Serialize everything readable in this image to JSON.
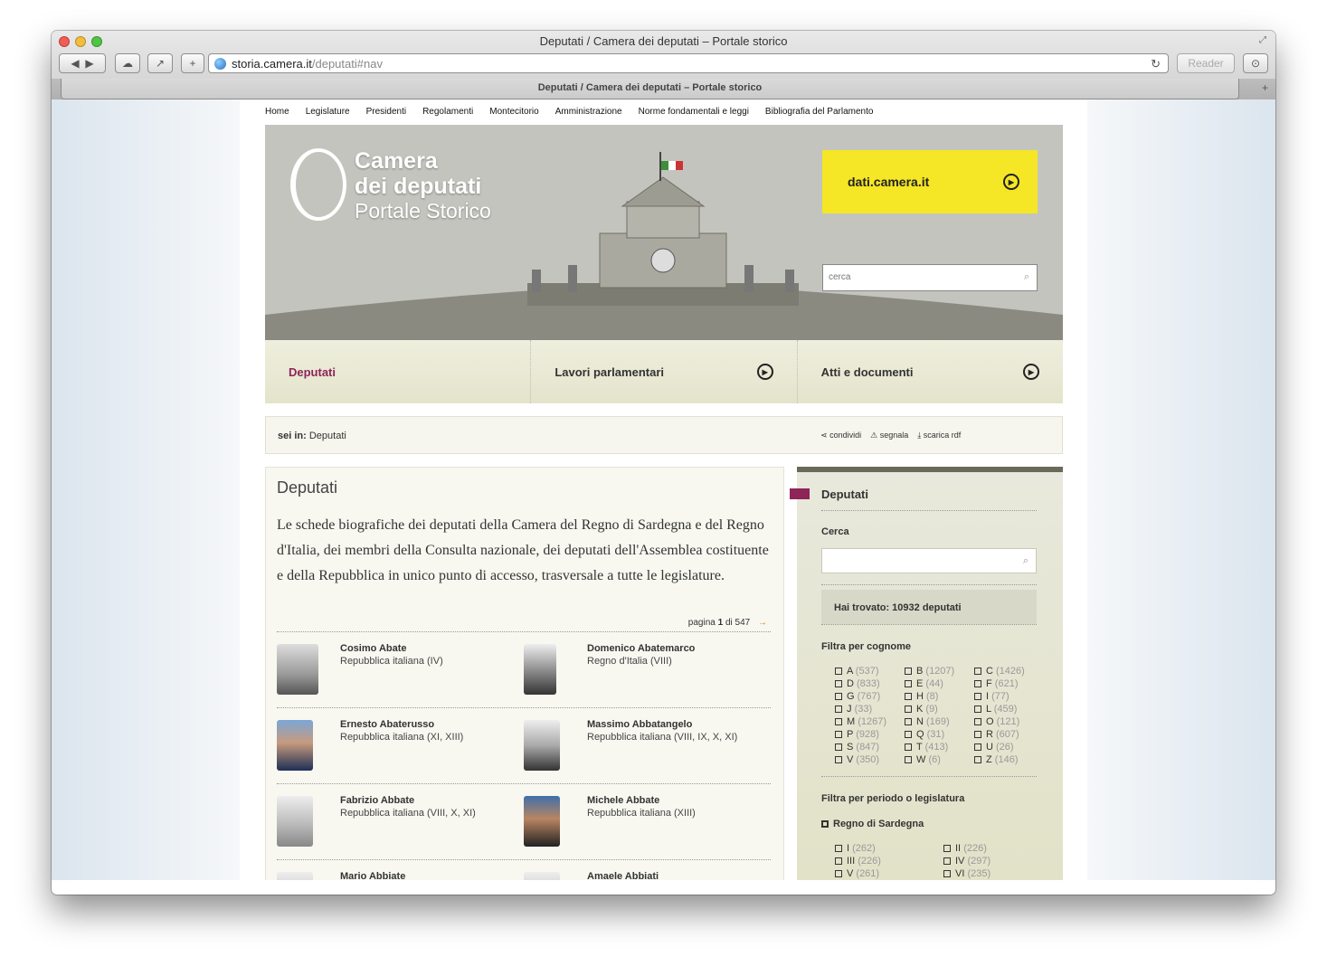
{
  "window": {
    "title": "Deputati / Camera dei deputati – Portale storico",
    "tab_title": "Deputati / Camera dei deputati – Portale storico"
  },
  "toolbar": {
    "back": "◀",
    "forward": "▶",
    "add": "+",
    "reader": "Reader"
  },
  "url": {
    "host": "storia.camera.it",
    "path": "/deputati#nav"
  },
  "topnav": [
    "Home",
    "Legislature",
    "Presidenti",
    "Regolamenti",
    "Montecitorio",
    "Amministrazione",
    "Norme fondamentali e leggi",
    "Bibliografia del Parlamento"
  ],
  "hero": {
    "logo_line1": "Camera",
    "logo_line2": "dei deputati",
    "logo_line3": "Portale Storico",
    "dati_label": "dati.camera.it",
    "search_placeholder": "cerca"
  },
  "sections": [
    {
      "label": "Deputati"
    },
    {
      "label": "Lavori parlamentari"
    },
    {
      "label": "Atti e documenti"
    }
  ],
  "breadcrumb": {
    "prefix": "sei in:",
    "current": "Deputati",
    "share": "condividi",
    "report": "segnala",
    "download": "scarica rdf"
  },
  "main": {
    "title": "Deputati",
    "intro": "Le schede biografiche dei deputati della Camera del Regno di Sardegna e del Regno d'Italia, dei membri della Consulta nazionale, dei deputati dell'Assemblea costituente e della Repubblica in unico punto di accesso, trasversale a tutte le legislature.",
    "pager_word": "pagina",
    "page_current": "1",
    "pager_of": "di",
    "page_total": "547",
    "deputies": [
      {
        "name": "Cosimo Abate",
        "leg": "Repubblica italiana (IV)"
      },
      {
        "name": "Domenico Abatemarco",
        "leg": "Regno d'Italia (VIII)"
      },
      {
        "name": "Ernesto Abaterusso",
        "leg": "Repubblica italiana (XI, XIII)"
      },
      {
        "name": "Massimo Abbatangelo",
        "leg": "Repubblica italiana (VIII, IX, X, XI)"
      },
      {
        "name": "Fabrizio Abbate",
        "leg": "Repubblica italiana (VIII, X, XI)"
      },
      {
        "name": "Michele Abbate",
        "leg": "Repubblica italiana (XIII)"
      },
      {
        "name": "Mario Abbiate",
        "leg": ""
      },
      {
        "name": "Amaele Abbiati",
        "leg": ""
      }
    ]
  },
  "sidebar": {
    "title": "Deputati",
    "search_label": "Cerca",
    "found": "Hai trovato: 10932 deputati",
    "filter_surname": "Filtra per cognome",
    "letters": [
      {
        "l": "A",
        "c": "(537)"
      },
      {
        "l": "B",
        "c": "(1207)"
      },
      {
        "l": "C",
        "c": "(1426)"
      },
      {
        "l": "D",
        "c": "(833)"
      },
      {
        "l": "E",
        "c": "(44)"
      },
      {
        "l": "F",
        "c": "(621)"
      },
      {
        "l": "G",
        "c": "(767)"
      },
      {
        "l": "H",
        "c": "(8)"
      },
      {
        "l": "I",
        "c": "(77)"
      },
      {
        "l": "J",
        "c": "(33)"
      },
      {
        "l": "K",
        "c": "(9)"
      },
      {
        "l": "L",
        "c": "(459)"
      },
      {
        "l": "M",
        "c": "(1267)"
      },
      {
        "l": "N",
        "c": "(169)"
      },
      {
        "l": "O",
        "c": "(121)"
      },
      {
        "l": "P",
        "c": "(928)"
      },
      {
        "l": "Q",
        "c": "(31)"
      },
      {
        "l": "R",
        "c": "(607)"
      },
      {
        "l": "S",
        "c": "(847)"
      },
      {
        "l": "T",
        "c": "(413)"
      },
      {
        "l": "U",
        "c": "(26)"
      },
      {
        "l": "V",
        "c": "(350)"
      },
      {
        "l": "W",
        "c": "(6)"
      },
      {
        "l": "Z",
        "c": "(146)"
      }
    ],
    "filter_period": "Filtra per periodo o legislatura",
    "group": "Regno di Sardegna",
    "legislatures": [
      {
        "l": "I",
        "c": "(262)"
      },
      {
        "l": "II",
        "c": "(226)"
      },
      {
        "l": "III",
        "c": "(226)"
      },
      {
        "l": "IV",
        "c": "(297)"
      },
      {
        "l": "V",
        "c": "(261)"
      },
      {
        "l": "VI",
        "c": "(235)"
      }
    ]
  }
}
